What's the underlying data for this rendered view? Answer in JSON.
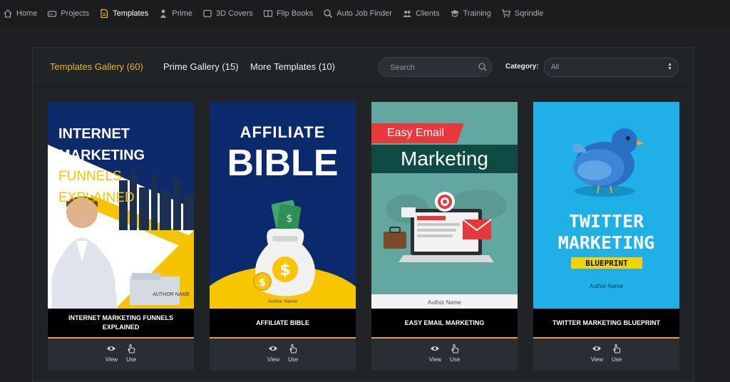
{
  "nav": [
    {
      "label": "Home",
      "icon": "home-icon"
    },
    {
      "label": "Projects",
      "icon": "drive-icon"
    },
    {
      "label": "Templates",
      "icon": "document-icon",
      "active": true
    },
    {
      "label": "Prime",
      "icon": "prime-icon"
    },
    {
      "label": "3D Covers",
      "icon": "cover-icon"
    },
    {
      "label": "Flip Books",
      "icon": "book-icon"
    },
    {
      "label": "Auto Job Finder",
      "icon": "search-icon"
    },
    {
      "label": "Clients",
      "icon": "clients-icon"
    },
    {
      "label": "Training",
      "icon": "training-icon"
    },
    {
      "label": "Sqrindle",
      "icon": "cart-icon"
    }
  ],
  "tabs": {
    "templates": "Templates Gallery (60)",
    "prime": "Prime Gallery (15)",
    "more": "More Templates (10)"
  },
  "search": {
    "placeholder": "Search"
  },
  "category": {
    "label": "Category:",
    "value": "All"
  },
  "colors": {
    "accent": "#e9b526"
  },
  "cards": [
    {
      "title": "INTERNET MARKETING FUNNELS EXPLAINED",
      "cover": {
        "line1": "INTERNET",
        "line2": "MARKETING",
        "line3": "FUNNELS EXPLAINED",
        "author": "AUTHOR NAME"
      }
    },
    {
      "title": "AFFILIATE BIBLE",
      "cover": {
        "line1": "AFFILIATE",
        "line2": "BIBLE",
        "author": "Author Name"
      }
    },
    {
      "title": "EASY EMAIL MARKETING",
      "cover": {
        "line1": "Easy Email",
        "line2": "Marketing",
        "author": "Author Name"
      }
    },
    {
      "title": "TWITTER MARKETING BLUEPRINT",
      "cover": {
        "line1": "TWITTER",
        "line2": "MARKETING",
        "line3": "BLUEPRINT",
        "author": "Author Name"
      }
    }
  ],
  "actions": {
    "view": "View",
    "use": "Use"
  }
}
